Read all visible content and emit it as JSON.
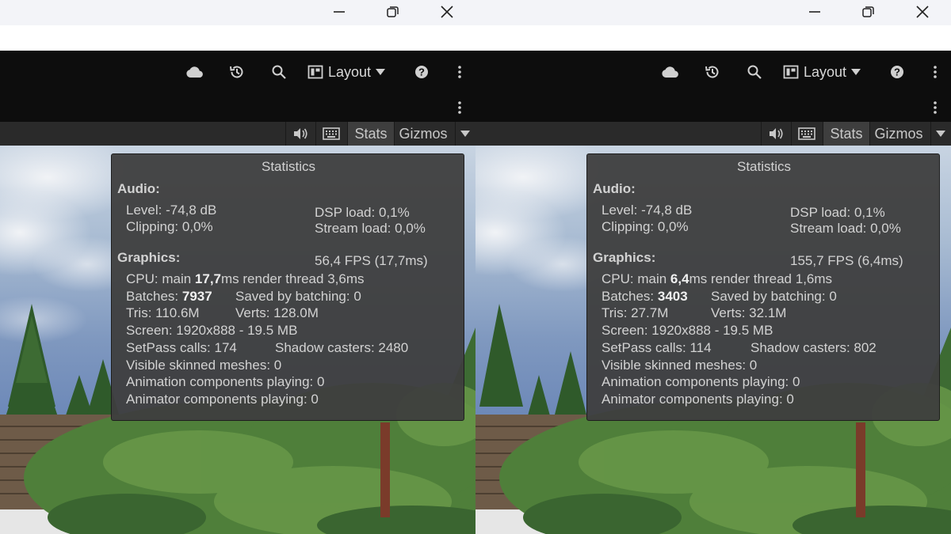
{
  "toolbar": {
    "layout_label": "Layout"
  },
  "scene_header": {
    "stats_label": "Stats",
    "gizmos_label": "Gizmos"
  },
  "panes": [
    {
      "stats": {
        "title": "Statistics",
        "audio_heading": "Audio:",
        "level": "Level: -74,8 dB",
        "dsp_load": "DSP load: 0,1%",
        "clipping": "Clipping: 0,0%",
        "stream_load": "Stream load: 0,0%",
        "graphics_heading": "Graphics:",
        "fps": "56,4 FPS (17,7ms)",
        "cpu_prefix": "CPU: main ",
        "cpu_main": "17,7",
        "cpu_suffix": "ms  render thread 3,6ms",
        "batches_prefix": "Batches: ",
        "batches": "7937",
        "saved_by_batching": "Saved by batching: 0",
        "tris": "Tris: 110.6M",
        "verts": "Verts: 128.0M",
        "screen": "Screen: 1920x888 - 19.5 MB",
        "setpass": "SetPass calls: 174",
        "shadow_casters": "Shadow casters: 2480",
        "visible_skinned": "Visible skinned meshes: 0",
        "animation_components": "Animation components playing: 0",
        "animator_components": "Animator components playing: 0"
      }
    },
    {
      "stats": {
        "title": "Statistics",
        "audio_heading": "Audio:",
        "level": "Level: -74,8 dB",
        "dsp_load": "DSP load: 0,1%",
        "clipping": "Clipping: 0,0%",
        "stream_load": "Stream load: 0,0%",
        "graphics_heading": "Graphics:",
        "fps": "155,7 FPS (6,4ms)",
        "cpu_prefix": "CPU: main ",
        "cpu_main": "6,4",
        "cpu_suffix": "ms  render thread 1,6ms",
        "batches_prefix": "Batches: ",
        "batches": "3403",
        "saved_by_batching": "Saved by batching: 0",
        "tris": "Tris: 27.7M",
        "verts": "Verts: 32.1M",
        "screen": "Screen: 1920x888 - 19.5 MB",
        "setpass": "SetPass calls: 114",
        "shadow_casters": "Shadow casters: 802",
        "visible_skinned": "Visible skinned meshes: 0",
        "animation_components": "Animation components playing: 0",
        "animator_components": "Animator components playing: 0"
      }
    }
  ],
  "icons": [
    "minimize-icon",
    "restore-icon",
    "close-icon",
    "cloud-icon",
    "history-icon",
    "search-icon",
    "layout-icon",
    "dropdown-icon",
    "help-icon",
    "more-icon",
    "audio-icon",
    "keyboard-icon"
  ],
  "colors": {
    "toolbar_bg": "#0d0d0d",
    "scene_header_bg": "#2a2a2a",
    "stats_bg": "#3e3e3e",
    "stats_text": "#d2d2d2"
  }
}
